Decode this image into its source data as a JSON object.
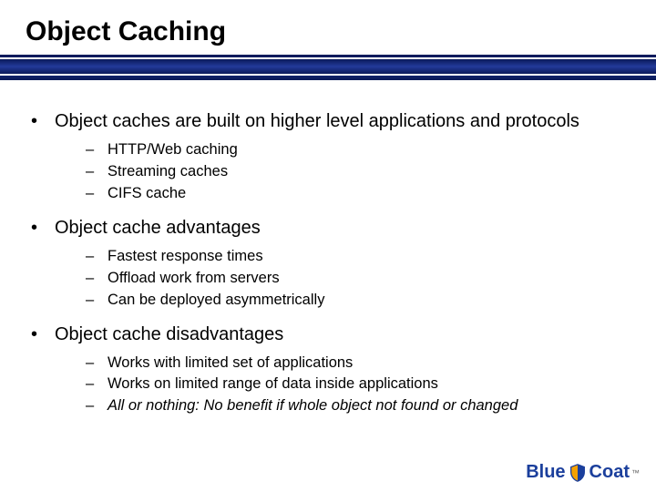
{
  "title": "Object Caching",
  "bullets": {
    "b0": {
      "text": "Object caches are built on higher level applications and protocols",
      "subs": {
        "s0": "HTTP/Web caching",
        "s1": "Streaming caches",
        "s2": "CIFS cache"
      }
    },
    "b1": {
      "text": "Object cache advantages",
      "subs": {
        "s0": "Fastest response times",
        "s1": "Offload work from servers",
        "s2": "Can be deployed asymmetrically"
      }
    },
    "b2": {
      "text": "Object cache disadvantages",
      "subs": {
        "s0": "Works with limited set of applications",
        "s1": "Works on limited range of data inside applications",
        "s2": "All or nothing: No benefit if whole object not found or changed"
      }
    }
  },
  "logo": {
    "blue": "Blue",
    "coat": "Coat",
    "tm": "™"
  },
  "glyphs": {
    "dot": "•",
    "dash": "–"
  }
}
